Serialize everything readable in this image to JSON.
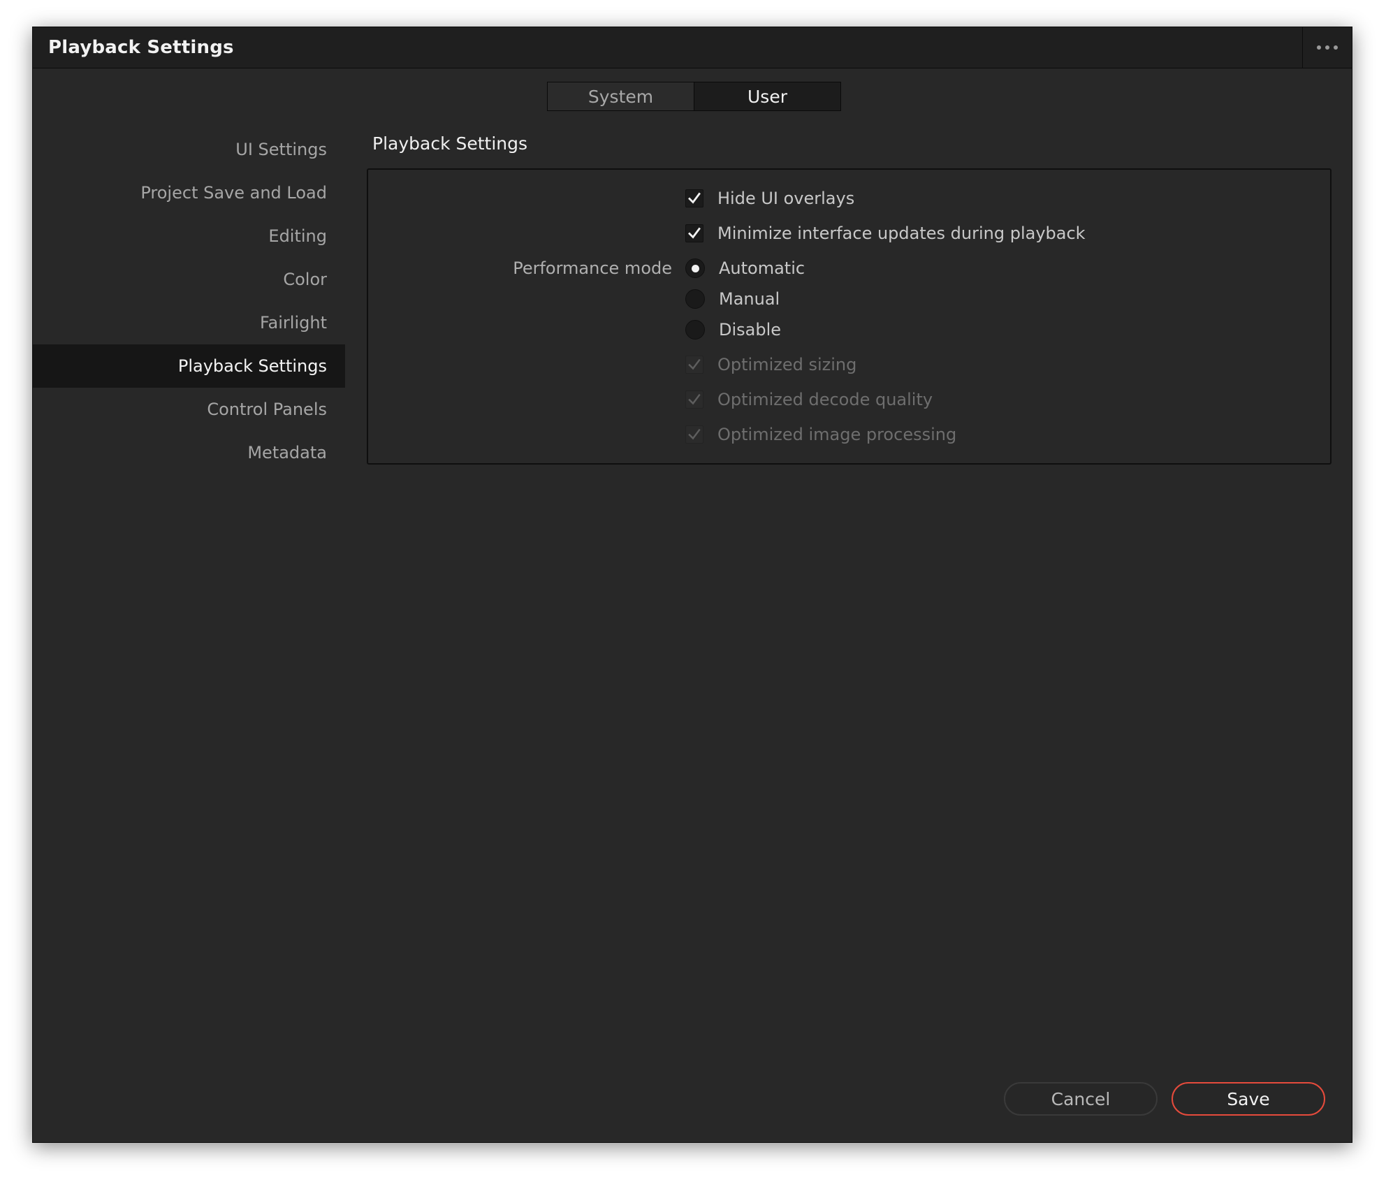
{
  "window": {
    "title": "Playback Settings",
    "more_icon": "more-horizontal-icon"
  },
  "tabs": [
    {
      "label": "System",
      "selected": false
    },
    {
      "label": "User",
      "selected": true
    }
  ],
  "sidebar": {
    "items": [
      {
        "label": "UI Settings",
        "active": false
      },
      {
        "label": "Project Save and Load",
        "active": false
      },
      {
        "label": "Editing",
        "active": false
      },
      {
        "label": "Color",
        "active": false
      },
      {
        "label": "Fairlight",
        "active": false
      },
      {
        "label": "Playback Settings",
        "active": true
      },
      {
        "label": "Control Panels",
        "active": false
      },
      {
        "label": "Metadata",
        "active": false
      }
    ]
  },
  "section": {
    "title": "Playback Settings",
    "hide_ui_overlays": {
      "label": "Hide UI overlays",
      "checked": true
    },
    "minimize_updates": {
      "label": "Minimize interface updates during playback",
      "checked": true
    },
    "performance_mode": {
      "label": "Performance mode",
      "options": [
        {
          "label": "Automatic",
          "selected": true
        },
        {
          "label": "Manual",
          "selected": false
        },
        {
          "label": "Disable",
          "selected": false
        }
      ]
    },
    "optimized_sizing": {
      "label": "Optimized sizing",
      "checked": true,
      "disabled": true
    },
    "optimized_decode": {
      "label": "Optimized decode quality",
      "checked": true,
      "disabled": true
    },
    "optimized_image": {
      "label": "Optimized image processing",
      "checked": true,
      "disabled": true
    }
  },
  "footer": {
    "cancel_label": "Cancel",
    "save_label": "Save"
  },
  "colors": {
    "window_bg": "#282828",
    "titlebar_bg": "#1f1f1f",
    "accent_save_border": "#e64b3c",
    "active_nav_bg": "#161616"
  }
}
